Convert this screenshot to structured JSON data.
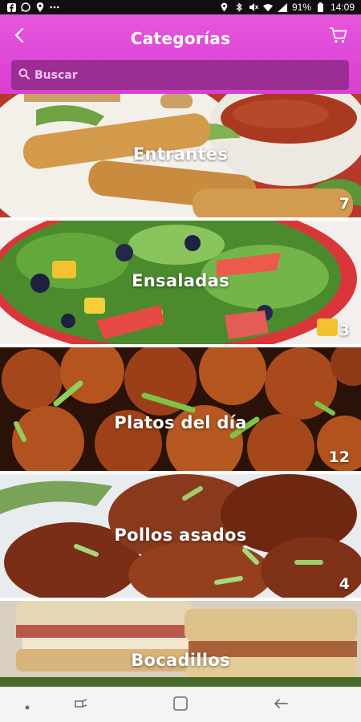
{
  "status_bar": {
    "battery": "91%",
    "time": "14:09",
    "left_icons": [
      "facebook-icon",
      "whatsapp-icon",
      "location-icon",
      "more-icon"
    ],
    "right_icons": [
      "location-icon",
      "bluetooth-icon",
      "mute-icon",
      "wifi-icon",
      "signal-icon",
      "battery-icon"
    ]
  },
  "header": {
    "title": "Categorías",
    "back_icon": "back-arrow-icon",
    "cart_icon": "cart-icon"
  },
  "search": {
    "placeholder": "Buscar",
    "value": ""
  },
  "categories": [
    {
      "name": "Entrantes",
      "count": "7"
    },
    {
      "name": "Ensaladas",
      "count": "3"
    },
    {
      "name": "Platos del día",
      "count": "12"
    },
    {
      "name": "Pollos asados",
      "count": "4"
    },
    {
      "name": "Bocadillos",
      "count": ""
    }
  ],
  "nav_bar": [
    "dot-icon",
    "recents-icon",
    "home-icon",
    "back-icon"
  ],
  "colors": {
    "header": "#e04bd8",
    "search_bg": "#9b2e93",
    "text": "#ffffff"
  }
}
